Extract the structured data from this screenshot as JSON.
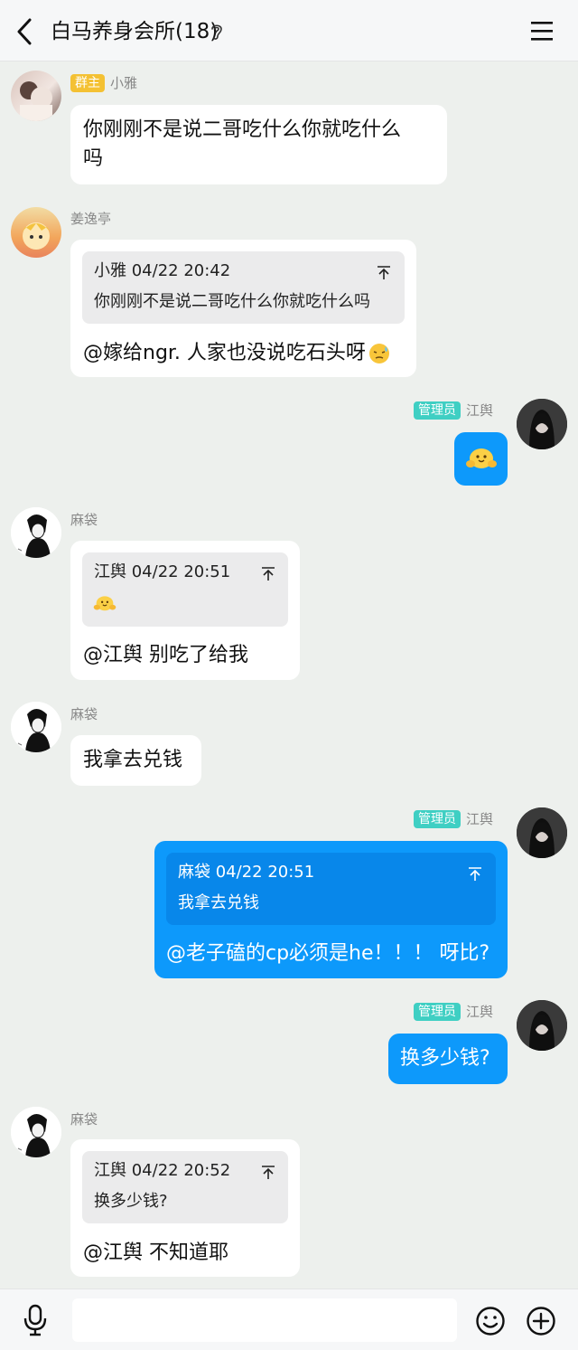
{
  "header": {
    "title": "白马养身会所(18)"
  },
  "messages": [
    {
      "sender": "小雅",
      "badge": "群主",
      "text_line1": "你刚刚不是说二哥吃什么你就吃什么",
      "text_line2": "吗"
    },
    {
      "sender": "姜逸亭",
      "quote_meta": "小雅 04/22 20:42",
      "quote_text": "你刚刚不是说二哥吃什么你就吃什么吗",
      "text": "@嫁给ngr. 人家也没说吃石头呀"
    },
    {
      "sender": "江舆",
      "badge": "管理员"
    },
    {
      "sender": "麻袋",
      "quote_meta": "江舆 04/22 20:51",
      "text": "@江舆 别吃了给我"
    },
    {
      "sender": "麻袋",
      "text": "我拿去兑钱"
    },
    {
      "sender": "江舆",
      "badge": "管理员",
      "quote_meta": "麻袋 04/22 20:51",
      "quote_text": "我拿去兑钱",
      "text": "@老子磕的cp必须是he！！！ 呀比?"
    },
    {
      "sender": "江舆",
      "badge": "管理员",
      "text": "换多少钱?"
    },
    {
      "sender": "麻袋",
      "quote_meta": "江舆 04/22 20:52",
      "quote_text": "换多少钱?",
      "text": "@江舆 不知道耶"
    }
  ],
  "colors": {
    "outgoing_bubble": "#0d99fb",
    "owner_badge": "#f4c133",
    "admin_badge": "#3fcfc3",
    "background": "#edf0ed"
  }
}
